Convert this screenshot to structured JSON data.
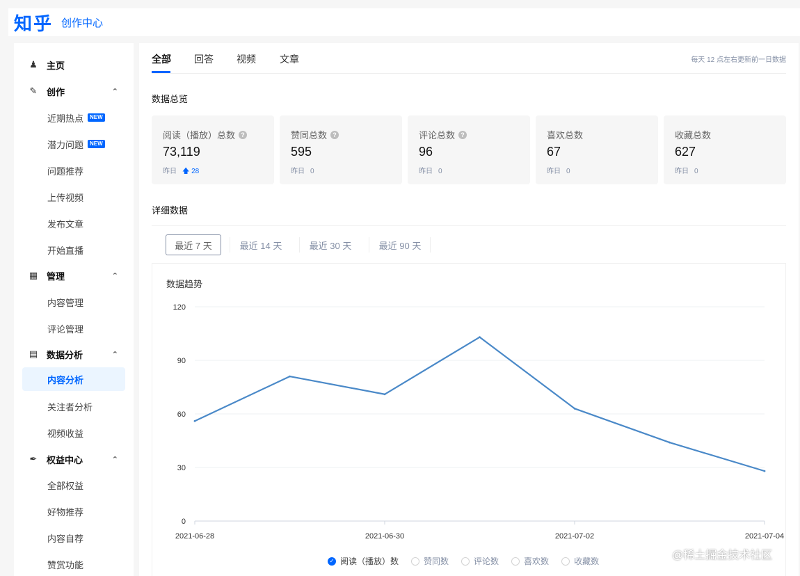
{
  "header": {
    "logo": "知乎",
    "title": "创作中心"
  },
  "sidebar": {
    "groups": [
      {
        "label": "主页",
        "icon": "user-icon"
      },
      {
        "label": "创作",
        "icon": "pencil-icon",
        "items": [
          {
            "label": "近期热点",
            "badge": "NEW"
          },
          {
            "label": "潜力问题",
            "badge": "NEW"
          },
          {
            "label": "问题推荐"
          },
          {
            "label": "上传视频"
          },
          {
            "label": "发布文章"
          },
          {
            "label": "开始直播"
          }
        ]
      },
      {
        "label": "管理",
        "icon": "grid-icon",
        "items": [
          {
            "label": "内容管理"
          },
          {
            "label": "评论管理"
          }
        ]
      },
      {
        "label": "数据分析",
        "icon": "bar-chart-icon",
        "items": [
          {
            "label": "内容分析",
            "active": true
          },
          {
            "label": "关注者分析"
          },
          {
            "label": "视频收益"
          }
        ]
      },
      {
        "label": "权益中心",
        "icon": "feather-icon",
        "items": [
          {
            "label": "全部权益"
          },
          {
            "label": "好物推荐"
          },
          {
            "label": "内容自荐"
          },
          {
            "label": "赞赏功能"
          }
        ]
      }
    ]
  },
  "main": {
    "tabs": [
      "全部",
      "回答",
      "视频",
      "文章"
    ],
    "active_tab": "全部",
    "update_note": "每天 12 点左右更新前一日数据",
    "overview_title": "数据总览",
    "cards": [
      {
        "label": "阅读（播放）总数",
        "help": true,
        "value": "73,119",
        "yesterday_label": "昨日",
        "yesterday": "28",
        "trend": "up"
      },
      {
        "label": "赞同总数",
        "help": true,
        "value": "595",
        "yesterday_label": "昨日",
        "yesterday": "0"
      },
      {
        "label": "评论总数",
        "help": true,
        "value": "96",
        "yesterday_label": "昨日",
        "yesterday": "0"
      },
      {
        "label": "喜欢总数",
        "help": false,
        "value": "67",
        "yesterday_label": "昨日",
        "yesterday": "0"
      },
      {
        "label": "收藏总数",
        "help": false,
        "value": "627",
        "yesterday_label": "昨日",
        "yesterday": "0"
      }
    ],
    "detail_title": "详细数据",
    "ranges": [
      "最近 7 天",
      "最近 14 天",
      "最近 30 天",
      "最近 90 天"
    ],
    "active_range": "最近 7 天",
    "chart_title": "数据趋势",
    "legend": [
      {
        "label": "阅读（播放）数",
        "checked": true
      },
      {
        "label": "赞同数",
        "checked": false
      },
      {
        "label": "评论数",
        "checked": false
      },
      {
        "label": "喜欢数",
        "checked": false
      },
      {
        "label": "收藏数",
        "checked": false
      }
    ]
  },
  "chart_data": {
    "type": "line",
    "x": [
      "2021-06-28",
      "2021-06-29",
      "2021-06-30",
      "2021-07-01",
      "2021-07-02",
      "2021-07-03",
      "2021-07-04"
    ],
    "x_tick_labels": [
      "2021-06-28",
      "2021-06-30",
      "2021-07-02",
      "2021-07-04"
    ],
    "series": [
      {
        "name": "阅读（播放）数",
        "values": [
          56,
          81,
          71,
          103,
          63,
          44,
          28
        ]
      }
    ],
    "yticks": [
      0,
      30,
      60,
      90,
      120
    ],
    "ylim": [
      0,
      120
    ],
    "grid": true,
    "line_color": "#4a89c8"
  },
  "watermark": "@稀土掘金技术社区"
}
